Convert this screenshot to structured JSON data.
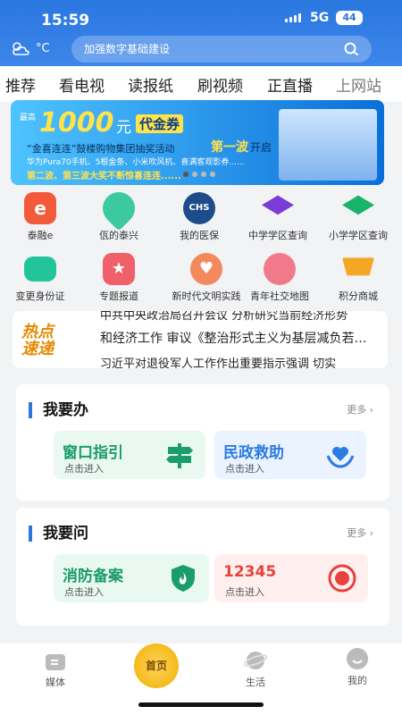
{
  "status": {
    "time": "15:59",
    "network": "5G",
    "battery": "44"
  },
  "weather": {
    "unit": "°C"
  },
  "search": {
    "placeholder": "加强数字基础建设"
  },
  "tabs": [
    "推荐",
    "看电视",
    "读报纸",
    "刷视频",
    "正直播",
    "上网站"
  ],
  "banner": {
    "prefix": "最高",
    "amount": "1000",
    "unit": "元",
    "coupon": "代金券",
    "line1": "“金喜连连”鼓楼购物集团抽奖活动",
    "wave": "第一波",
    "open": "开启",
    "line2": "华为Pura70手机、5根金条、小米吹风机、喜满客观影券......",
    "line3": "第二波、第三波大奖不断惊喜连连......"
  },
  "grid": [
    {
      "label": "泰融e",
      "icon": "taironge-icon",
      "color": "#f25a3a"
    },
    {
      "label": "佤的泰兴",
      "icon": "location-pin-icon",
      "color": "#3cc8a0"
    },
    {
      "label": "我的医保",
      "icon": "chs-icon",
      "color": "#1d4c8a"
    },
    {
      "label": "中学学区查询",
      "icon": "graduation-cap-icon",
      "color": "#7b3bd6"
    },
    {
      "label": "小学学区查询",
      "icon": "graduation-cap-green-icon",
      "color": "#19b46a"
    },
    {
      "label": "变更身份证",
      "icon": "id-card-icon",
      "color": "#22c59a"
    },
    {
      "label": "专题报道",
      "icon": "star-report-icon",
      "color": "#f0606a"
    },
    {
      "label": "新时代文明实践",
      "icon": "heart-hands-icon",
      "color": "#f28a5e"
    },
    {
      "label": "青年社交地图",
      "icon": "people-icon",
      "color": "#f07a8a"
    },
    {
      "label": "积分商城",
      "icon": "cart-icon",
      "color": "#f5a623"
    }
  ],
  "news": {
    "tag_line1": "热点",
    "tag_line2": "速递",
    "lines": [
      "中共中央政治局召开会议 分析研究当前经济形势",
      "和经济工作 审议《整治形式主义为基层减负若…",
      "习近平对退役军人工作作出重要指示强调 切实"
    ]
  },
  "card1": {
    "title": "我要办",
    "more": "更多",
    "tiles": [
      {
        "title": "窗口指引",
        "sub": "点击进入",
        "color": "#e9f8f1",
        "text_color": "#1a9c6c"
      },
      {
        "title": "民政救助",
        "sub": "点击进入",
        "color": "#eaf3ff",
        "text_color": "#2b7be2"
      }
    ]
  },
  "card2": {
    "title": "我要问",
    "more": "更多",
    "tiles": [
      {
        "title": "消防备案",
        "sub": "点击进入",
        "color": "#e9f8f1",
        "text_color": "#1a9c6c"
      },
      {
        "title": "12345",
        "sub": "点击进入",
        "color": "#fff0ef",
        "text_color": "#e8423c"
      }
    ]
  },
  "bottom_nav": [
    {
      "label": "媒体",
      "icon": "media-icon"
    },
    {
      "label": "首页",
      "icon": "home-icon"
    },
    {
      "label": "生活",
      "icon": "planet-icon"
    },
    {
      "label": "我的",
      "icon": "profile-icon"
    }
  ]
}
